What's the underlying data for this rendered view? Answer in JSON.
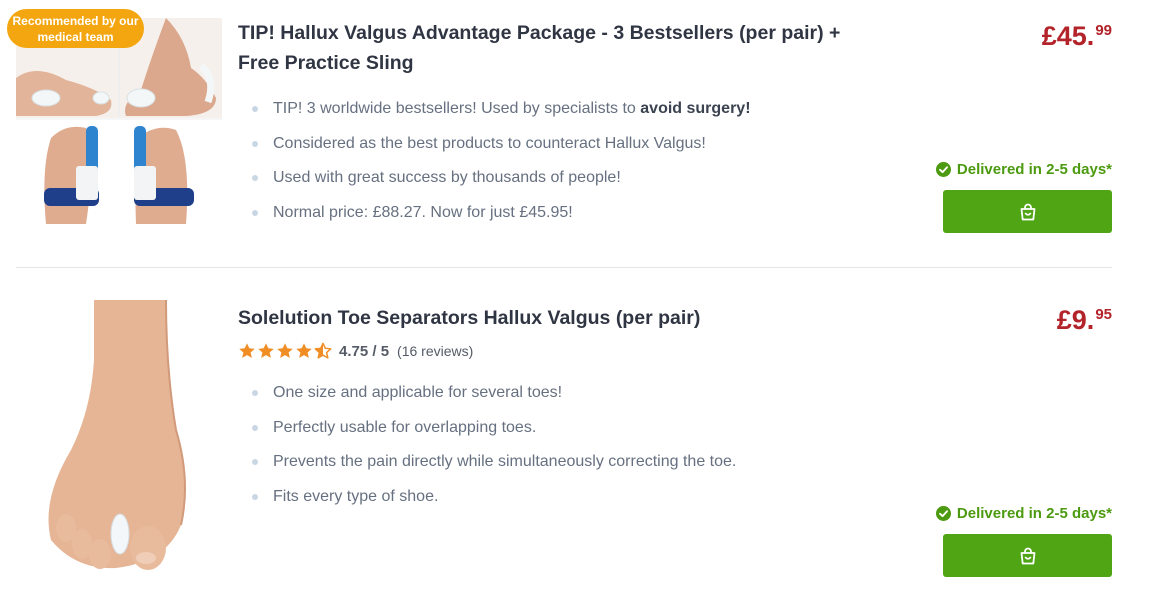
{
  "products": [
    {
      "badge": "Recommended by our medical team",
      "title": "TIP! Hallux Valgus Advantage Package - 3 Bestsellers (per pair) + Free Practice Sling",
      "bullets": [
        {
          "text": "TIP! 3 worldwide bestsellers! Used by specialists to ",
          "bold": "avoid surgery!"
        },
        {
          "text": "Considered as the best products to counteract Hallux Valgus!",
          "bold": ""
        },
        {
          "text": "Used with great success by thousands of people!",
          "bold": ""
        },
        {
          "text": "Normal price: £88.27. Now for just £45.95!",
          "bold": ""
        }
      ],
      "price_main": "£45.",
      "price_cents": "99",
      "delivery": "Delivered in 2-5 days*",
      "cart_icon": "shopping-bag-icon"
    },
    {
      "title": "Solelution Toe Separators Hallux Valgus (per pair)",
      "rating": {
        "stars": 4.75,
        "max": 5,
        "value_text": "4.75 / 5",
        "reviews_text": "(16 reviews)"
      },
      "bullets": [
        {
          "text": "One size and applicable for several toes!",
          "bold": ""
        },
        {
          "text": "Perfectly usable for overlapping toes.",
          "bold": ""
        },
        {
          "text": "Prevents the pain directly while simultaneously correcting the toe.",
          "bold": ""
        },
        {
          "text": "Fits every type of shoe.",
          "bold": ""
        }
      ],
      "price_main": "£9.",
      "price_cents": "95",
      "delivery": "Delivered in 2-5 days*",
      "cart_icon": "shopping-bag-icon"
    }
  ],
  "colors": {
    "price": "#b3232a",
    "delivery": "#4c9a0f",
    "button": "#4fa514",
    "badge": "#f3a60f",
    "star": "#f08d24"
  }
}
